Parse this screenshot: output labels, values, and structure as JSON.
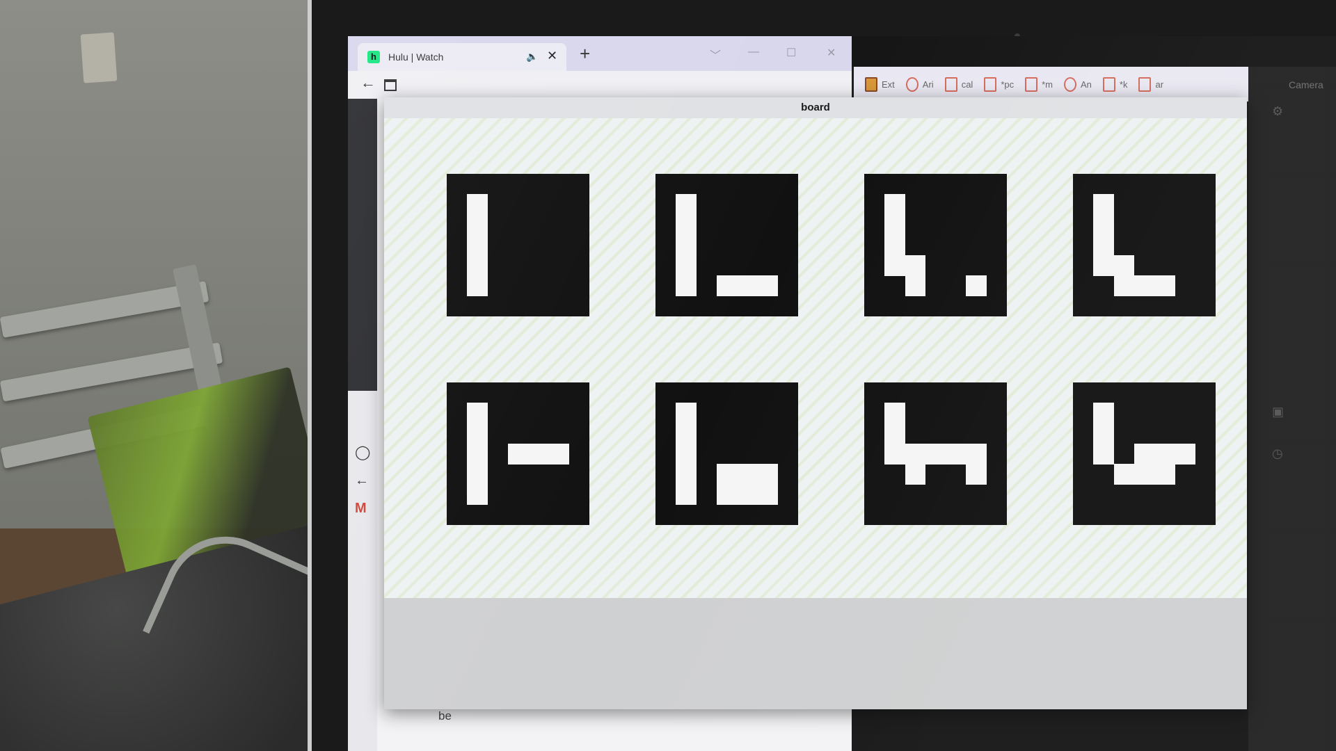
{
  "browser": {
    "tab_title": "Hulu | Watch",
    "favicon_letter": "h",
    "mute_icon": "speaker-icon",
    "close_glyph": "✕",
    "new_tab_glyph": "+",
    "back_glyph": "←",
    "window_controls": [
      "﹀",
      "—",
      "☐",
      "✕"
    ],
    "sidebar_icons": [
      "github-icon",
      "back-arrow-icon",
      "gmail-icon"
    ],
    "sidebar_glyphs": [
      "◯",
      "←",
      "M"
    ],
    "footer_fragment": "be"
  },
  "bookmarks": {
    "items": [
      {
        "label": "Ext",
        "icon": "app-icon"
      },
      {
        "label": "Ari",
        "icon": "circle-icon"
      },
      {
        "label": "cal",
        "icon": "page-icon"
      },
      {
        "label": "*pc",
        "icon": "page-icon"
      },
      {
        "label": "*m",
        "icon": "page-icon"
      },
      {
        "label": "An",
        "icon": "circle-icon"
      },
      {
        "label": "*k",
        "icon": "page-icon"
      },
      {
        "label": "ar",
        "icon": "page-icon"
      }
    ]
  },
  "camera_panel": {
    "label": "Camera"
  },
  "board": {
    "title": "board",
    "markers": [
      {
        "id": "marker-1",
        "grid": [
          [
            1,
            1,
            1,
            1,
            1,
            1,
            1
          ],
          [
            1,
            0,
            1,
            1,
            1,
            1,
            1
          ],
          [
            1,
            0,
            1,
            1,
            1,
            1,
            1
          ],
          [
            1,
            0,
            1,
            1,
            1,
            1,
            1
          ],
          [
            1,
            0,
            1,
            1,
            1,
            1,
            1
          ],
          [
            1,
            0,
            1,
            1,
            1,
            1,
            1
          ],
          [
            1,
            1,
            1,
            1,
            1,
            1,
            1
          ]
        ]
      },
      {
        "id": "marker-2",
        "grid": [
          [
            1,
            1,
            1,
            1,
            1,
            1,
            1
          ],
          [
            1,
            0,
            1,
            1,
            1,
            1,
            1
          ],
          [
            1,
            0,
            1,
            1,
            1,
            1,
            1
          ],
          [
            1,
            0,
            1,
            1,
            1,
            1,
            1
          ],
          [
            1,
            0,
            1,
            1,
            1,
            1,
            1
          ],
          [
            1,
            0,
            1,
            0,
            0,
            0,
            1
          ],
          [
            1,
            1,
            1,
            1,
            1,
            1,
            1
          ]
        ]
      },
      {
        "id": "marker-3",
        "grid": [
          [
            1,
            1,
            1,
            1,
            1,
            1,
            1
          ],
          [
            1,
            0,
            1,
            1,
            1,
            1,
            1
          ],
          [
            1,
            0,
            1,
            1,
            1,
            1,
            1
          ],
          [
            1,
            0,
            1,
            1,
            1,
            1,
            1
          ],
          [
            1,
            0,
            0,
            1,
            1,
            1,
            1
          ],
          [
            1,
            1,
            0,
            1,
            1,
            0,
            1
          ],
          [
            1,
            1,
            1,
            1,
            1,
            1,
            1
          ]
        ]
      },
      {
        "id": "marker-4",
        "grid": [
          [
            1,
            1,
            1,
            1,
            1,
            1,
            1
          ],
          [
            1,
            0,
            1,
            1,
            1,
            1,
            1
          ],
          [
            1,
            0,
            1,
            1,
            1,
            1,
            1
          ],
          [
            1,
            0,
            1,
            1,
            1,
            1,
            1
          ],
          [
            1,
            0,
            0,
            1,
            1,
            1,
            1
          ],
          [
            1,
            1,
            0,
            0,
            0,
            1,
            1
          ],
          [
            1,
            1,
            1,
            1,
            1,
            1,
            1
          ]
        ]
      },
      {
        "id": "marker-5",
        "grid": [
          [
            1,
            1,
            1,
            1,
            1,
            1,
            1
          ],
          [
            1,
            0,
            1,
            1,
            1,
            1,
            1
          ],
          [
            1,
            0,
            1,
            1,
            1,
            1,
            1
          ],
          [
            1,
            0,
            1,
            0,
            0,
            0,
            1
          ],
          [
            1,
            0,
            1,
            1,
            1,
            1,
            1
          ],
          [
            1,
            0,
            1,
            1,
            1,
            1,
            1
          ],
          [
            1,
            1,
            1,
            1,
            1,
            1,
            1
          ]
        ]
      },
      {
        "id": "marker-6",
        "grid": [
          [
            1,
            1,
            1,
            1,
            1,
            1,
            1
          ],
          [
            1,
            0,
            1,
            1,
            1,
            1,
            1
          ],
          [
            1,
            0,
            1,
            1,
            1,
            1,
            1
          ],
          [
            1,
            0,
            1,
            1,
            1,
            1,
            1
          ],
          [
            1,
            0,
            1,
            0,
            0,
            0,
            1
          ],
          [
            1,
            0,
            1,
            0,
            0,
            0,
            1
          ],
          [
            1,
            1,
            1,
            1,
            1,
            1,
            1
          ]
        ]
      },
      {
        "id": "marker-7",
        "grid": [
          [
            1,
            1,
            1,
            1,
            1,
            1,
            1
          ],
          [
            1,
            0,
            1,
            1,
            1,
            1,
            1
          ],
          [
            1,
            0,
            1,
            1,
            1,
            1,
            1
          ],
          [
            1,
            0,
            0,
            0,
            0,
            0,
            1
          ],
          [
            1,
            1,
            0,
            1,
            1,
            0,
            1
          ],
          [
            1,
            1,
            1,
            1,
            1,
            1,
            1
          ],
          [
            1,
            1,
            1,
            1,
            1,
            1,
            1
          ]
        ]
      },
      {
        "id": "marker-8",
        "grid": [
          [
            1,
            1,
            1,
            1,
            1,
            1,
            1
          ],
          [
            1,
            0,
            1,
            1,
            1,
            1,
            1
          ],
          [
            1,
            0,
            1,
            1,
            1,
            1,
            1
          ],
          [
            1,
            0,
            1,
            0,
            0,
            0,
            1
          ],
          [
            1,
            1,
            0,
            0,
            0,
            1,
            1
          ],
          [
            1,
            1,
            1,
            1,
            1,
            1,
            1
          ],
          [
            1,
            1,
            1,
            1,
            1,
            1,
            1
          ]
        ]
      }
    ]
  }
}
